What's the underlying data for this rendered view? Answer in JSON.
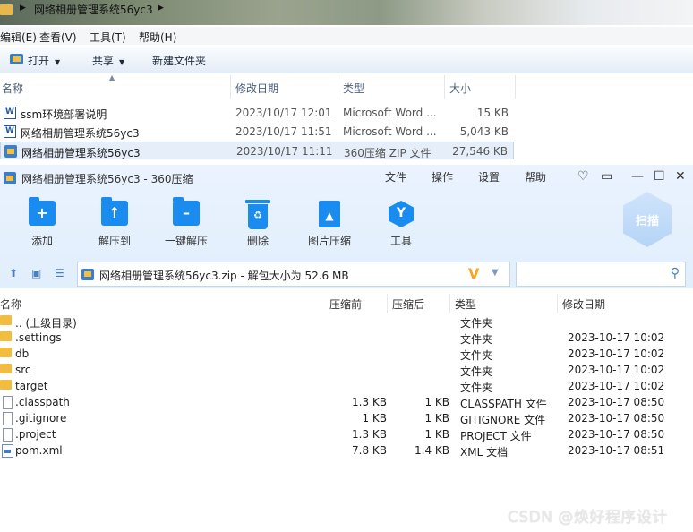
{
  "explorer": {
    "breadcrumb": "网络相册管理系统56yc3",
    "menu": [
      "编辑(E)",
      "查看(V)",
      "工具(T)",
      "帮助(H)"
    ],
    "commands": {
      "open": "打开",
      "share": "共享",
      "new_folder": "新建文件夹"
    },
    "columns": [
      "名称",
      "修改日期",
      "类型",
      "大小"
    ],
    "files": [
      {
        "name": "ssm环境部署说明",
        "date": "2023/10/17 12:01",
        "type": "Microsoft Word ...",
        "size": "15 KB",
        "icon": "word-doc-icon",
        "selected": false
      },
      {
        "name": "网络相册管理系统56yc3",
        "date": "2023/10/17 11:51",
        "type": "Microsoft Word ...",
        "size": "5,043 KB",
        "icon": "word-doc-icon",
        "selected": false
      },
      {
        "name": "网络相册管理系统56yc3",
        "date": "2023/10/17 11:11",
        "type": "360压缩 ZIP 文件",
        "size": "27,546 KB",
        "icon": "zip-archive-icon",
        "selected": true
      }
    ]
  },
  "zip": {
    "title": "网络相册管理系统56yc3 - 360压缩",
    "menu": [
      "文件",
      "操作",
      "设置",
      "帮助"
    ],
    "toolbar": [
      {
        "label": "添加",
        "icon": "add-icon"
      },
      {
        "label": "解压到",
        "icon": "extract-to-icon"
      },
      {
        "label": "一键解压",
        "icon": "one-click-extract-icon"
      },
      {
        "label": "删除",
        "icon": "delete-icon"
      },
      {
        "label": "图片压缩",
        "icon": "image-compress-icon"
      },
      {
        "label": "工具",
        "icon": "tools-icon"
      }
    ],
    "scan_label": "扫描",
    "path": "网络相册管理系统56yc3.zip - 解包大小为 52.6 MB",
    "columns": [
      "名称",
      "压缩前",
      "压缩后",
      "类型",
      "修改日期"
    ],
    "entries": [
      {
        "name": ".. (上级目录)",
        "before": "",
        "after": "",
        "type": "文件夹",
        "date": "",
        "icon": "folder-icon"
      },
      {
        "name": ".settings",
        "before": "",
        "after": "",
        "type": "文件夹",
        "date": "2023-10-17 10:02",
        "icon": "folder-icon"
      },
      {
        "name": "db",
        "before": "",
        "after": "",
        "type": "文件夹",
        "date": "2023-10-17 10:02",
        "icon": "folder-icon"
      },
      {
        "name": "src",
        "before": "",
        "after": "",
        "type": "文件夹",
        "date": "2023-10-17 10:02",
        "icon": "folder-icon"
      },
      {
        "name": "target",
        "before": "",
        "after": "",
        "type": "文件夹",
        "date": "2023-10-17 10:02",
        "icon": "folder-icon"
      },
      {
        "name": ".classpath",
        "before": "1.3 KB",
        "after": "1 KB",
        "type": "CLASSPATH 文件",
        "date": "2023-10-17 08:50",
        "icon": "file-icon"
      },
      {
        "name": ".gitignore",
        "before": "1 KB",
        "after": "1 KB",
        "type": "GITIGNORE 文件",
        "date": "2023-10-17 08:50",
        "icon": "file-icon"
      },
      {
        "name": ".project",
        "before": "1.3 KB",
        "after": "1 KB",
        "type": "PROJECT 文件",
        "date": "2023-10-17 08:50",
        "icon": "file-icon"
      },
      {
        "name": "pom.xml",
        "before": "7.8 KB",
        "after": "1.4 KB",
        "type": "XML 文档",
        "date": "2023-10-17 08:51",
        "icon": "xml-file-icon"
      }
    ]
  },
  "watermark": "CSDN @焕好程序设计",
  "colors": {
    "accent": "#1a8cf0",
    "folder": "#f0bd3e",
    "selection": "#e5eef9"
  }
}
